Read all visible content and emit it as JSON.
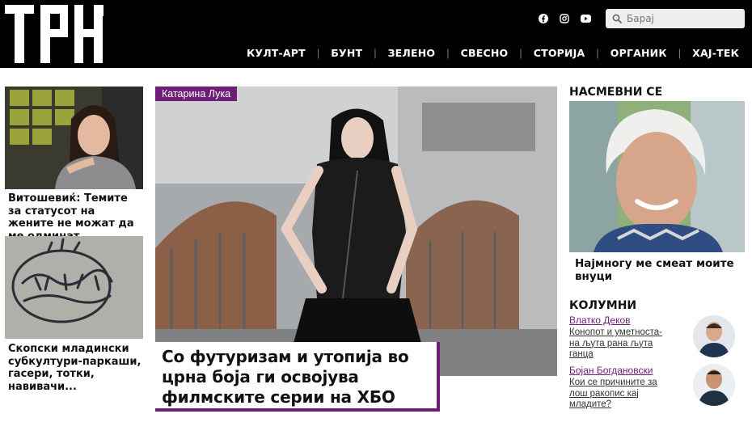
{
  "site": {
    "logo_text": "ТРН"
  },
  "header": {
    "social": [
      "facebook-icon",
      "instagram-icon",
      "youtube-icon"
    ],
    "search": {
      "placeholder": "Барај",
      "value": ""
    },
    "nav": [
      "КУЛТ-АРТ",
      "БУНТ",
      "ЗЕЛЕНО",
      "СВЕСНО",
      "СТОРИЈА",
      "ОРГАНИК",
      "ХАЈ-ТЕК"
    ]
  },
  "left_articles": [
    {
      "title": "Витошевиќ: Темите за статусот на жените не можат да ме одминат"
    },
    {
      "title": "Скопски младински субкултури-паркаши, гасери, тотки, навивачи..."
    }
  ],
  "hero": {
    "author": "Катарина Лука",
    "title": "Со футуризам и утопија во црна боја ги освојува филмските серии на ХБО"
  },
  "smile": {
    "heading": "НАСМЕВНИ СЕ",
    "title": "Најмногу ме смеат моите внуци"
  },
  "columns": {
    "heading": "КОЛУМНИ",
    "items": [
      {
        "author": "Влатко Деков",
        "title": "Конопот и уметноста-на љута рана љута ганца"
      },
      {
        "author": "Бојан Богдановски",
        "title": "Кои се причините за лош ракопис кај младите?"
      }
    ]
  },
  "colors": {
    "accent": "#6e1f75",
    "header_bg": "#000000"
  }
}
